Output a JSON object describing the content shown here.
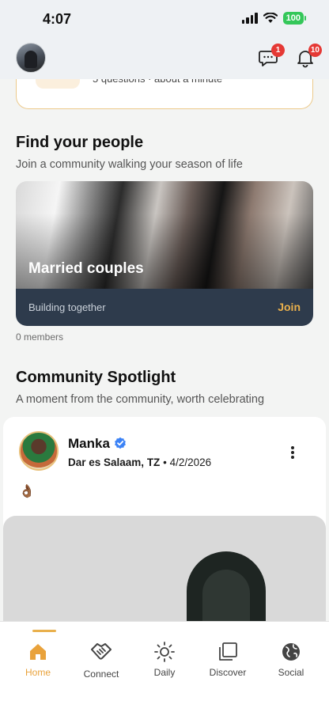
{
  "status_bar": {
    "time": "4:07",
    "battery": "100"
  },
  "header": {
    "messages_badge": "1",
    "notifications_badge": "10"
  },
  "quiz_card": {
    "text": "5 questions · about a minute"
  },
  "find_people": {
    "title": "Find your people",
    "subtitle": "Join a community walking your season of life",
    "community": {
      "name": "Married couples",
      "tagline": "Building together",
      "join_label": "Join",
      "members": "0 members"
    }
  },
  "spotlight": {
    "title": "Community Spotlight",
    "subtitle": "A moment from the community, worth celebrating",
    "post": {
      "author": "Manka",
      "location": "Dar es Salaam, TZ",
      "date": "4/2/2026",
      "content": "👌🏾"
    }
  },
  "tabs": [
    {
      "label": "Home",
      "icon": "home-icon",
      "active": true
    },
    {
      "label": "Connect",
      "icon": "handshake-icon",
      "active": false
    },
    {
      "label": "Daily",
      "icon": "sun-icon",
      "active": false
    },
    {
      "label": "Discover",
      "icon": "stack-icon",
      "active": false
    },
    {
      "label": "Social",
      "icon": "globe-icon",
      "active": false
    }
  ],
  "colors": {
    "accent": "#e9b04c",
    "badge": "#e53935",
    "card_footer": "#2e3b4c",
    "battery": "#34c759"
  }
}
